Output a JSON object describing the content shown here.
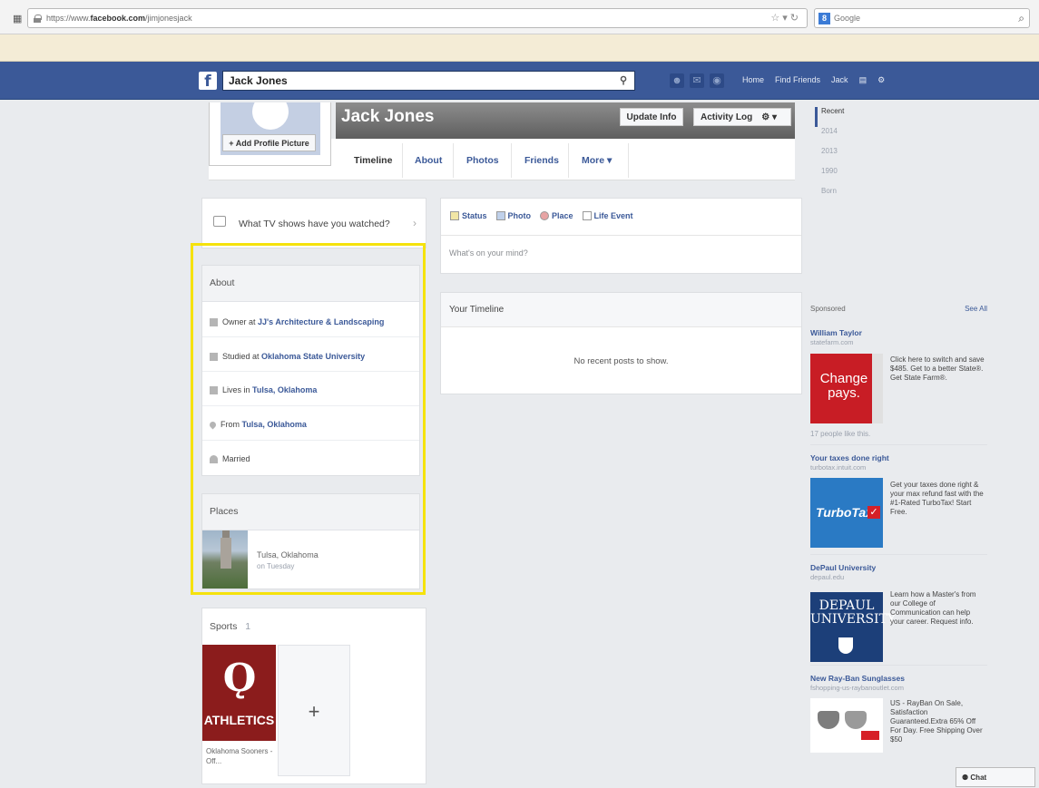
{
  "browser": {
    "url_prefix": "https://www.",
    "url_domain": "facebook.com",
    "url_path": "/jimjonesjack",
    "search_engine_label": "Google"
  },
  "header": {
    "logo": "f",
    "search_value": "Jack Jones",
    "nav": [
      "Home",
      "Find Friends",
      "Jack"
    ]
  },
  "profile": {
    "name": "Jack Jones",
    "add_picture": "+ Add Profile Picture",
    "update_info": "Update Info",
    "activity_log": "Activity Log",
    "tabs": [
      "Timeline",
      "About",
      "Photos",
      "Friends",
      "More ▾"
    ]
  },
  "scrubber": [
    "Recent",
    "2014",
    "2013",
    "1990",
    "Born"
  ],
  "tv_prompt": "What TV shows have you watched?",
  "about": {
    "title": "About",
    "items": [
      {
        "prefix": "Owner at ",
        "bold": "JJ's Architecture & Landscaping",
        "icon": "briefcase-icon"
      },
      {
        "prefix": "Studied at ",
        "bold": "Oklahoma State University",
        "icon": "school-icon"
      },
      {
        "prefix": "Lives in ",
        "bold": "Tulsa, Oklahoma",
        "icon": "home-icon"
      },
      {
        "prefix": "From ",
        "bold": "Tulsa, Oklahoma",
        "icon": "location-pin-icon"
      },
      {
        "prefix": "Married",
        "bold": "",
        "icon": "heart-icon"
      }
    ]
  },
  "places": {
    "title": "Places",
    "place_name": "Tulsa, Oklahoma",
    "place_when": "on Tuesday"
  },
  "sports": {
    "title": "Sports",
    "count": "1",
    "team_label": "ATHLETICS",
    "team_caption": "Oklahoma Sooners - Off...",
    "add_symbol": "+"
  },
  "composer": {
    "tabs": [
      "Status",
      "Photo",
      "Place",
      "Life Event"
    ],
    "placeholder": "What's on your mind?"
  },
  "timeline": {
    "title": "Your Timeline",
    "empty_message": "No recent posts to show."
  },
  "ads": {
    "heading": "Sponsored",
    "see_all": "See All",
    "items": [
      {
        "title": "William Taylor",
        "domain": "statefarm.com",
        "image_text": "Change pays.",
        "body": "Click here to switch and save $485. Get to a better State®. Get State Farm®.",
        "likes": "17 people like this."
      },
      {
        "title": "Your taxes done right",
        "domain": "turbotax.intuit.com",
        "image_text": "TurboTax",
        "body": "Get your taxes done right & your max refund fast with the #1-Rated TurboTax! Start Free."
      },
      {
        "title": "DePaul University",
        "domain": "depaul.edu",
        "image_text": "DEPAUL UNIVERSITY",
        "body": "Learn how a Master's from our College of Communication can help your career. Request info."
      },
      {
        "title": "New Ray-Ban Sunglasses",
        "domain": "fshopping-us-raybanoutlet.com",
        "body": "US - RayBan On Sale, Satisfaction Guaranteed.Extra 65% Off For Day. Free Shipping Over $50"
      }
    ]
  },
  "chat_label": "Chat"
}
